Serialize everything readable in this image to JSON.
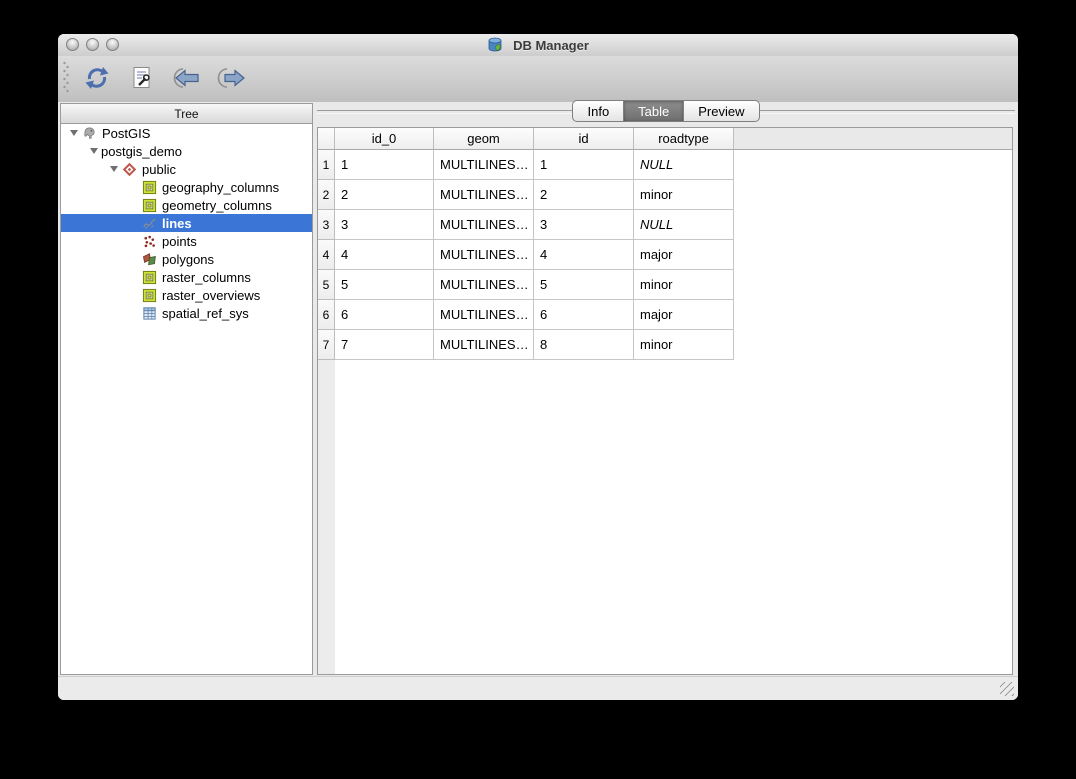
{
  "window": {
    "title": "DB Manager",
    "traffic_lights": [
      {
        "name": "close"
      },
      {
        "name": "minimize"
      },
      {
        "name": "zoom"
      }
    ]
  },
  "toolbar": {
    "buttons": [
      {
        "icon": "refresh-icon"
      },
      {
        "icon": "sql-window-icon"
      },
      {
        "icon": "import-layer-icon"
      },
      {
        "icon": "export-file-icon"
      }
    ]
  },
  "tree_panel": {
    "header": "Tree",
    "items": [
      {
        "label": "PostGIS",
        "depth": 0,
        "expanded": true,
        "icon": "postgis-icon",
        "selected": false
      },
      {
        "label": "postgis_demo",
        "depth": 1,
        "expanded": true,
        "icon": null,
        "selected": false
      },
      {
        "label": "public",
        "depth": 2,
        "expanded": true,
        "icon": "schema-icon",
        "selected": false
      },
      {
        "label": "geography_columns",
        "depth": 3,
        "expanded": false,
        "icon": "table-layer-icon",
        "selected": false
      },
      {
        "label": "geometry_columns",
        "depth": 3,
        "expanded": false,
        "icon": "table-layer-icon",
        "selected": false
      },
      {
        "label": "lines",
        "depth": 3,
        "expanded": false,
        "icon": "line-layer-icon",
        "selected": true
      },
      {
        "label": "points",
        "depth": 3,
        "expanded": false,
        "icon": "point-layer-icon",
        "selected": false
      },
      {
        "label": "polygons",
        "depth": 3,
        "expanded": false,
        "icon": "polygon-layer-icon",
        "selected": false
      },
      {
        "label": "raster_columns",
        "depth": 3,
        "expanded": false,
        "icon": "table-layer-icon",
        "selected": false
      },
      {
        "label": "raster_overviews",
        "depth": 3,
        "expanded": false,
        "icon": "table-layer-icon",
        "selected": false
      },
      {
        "label": "spatial_ref_sys",
        "depth": 3,
        "expanded": false,
        "icon": "spatial-table-icon",
        "selected": false
      }
    ]
  },
  "tabs": {
    "items": [
      {
        "label": "Info",
        "active": false
      },
      {
        "label": "Table",
        "active": true
      },
      {
        "label": "Preview",
        "active": false
      }
    ]
  },
  "table": {
    "columns": [
      "id_0",
      "geom",
      "id",
      "roadtype"
    ],
    "rows": [
      {
        "num": "1",
        "id_0": "1",
        "geom": "MULTILINES…",
        "id": "1",
        "roadtype": "NULL"
      },
      {
        "num": "2",
        "id_0": "2",
        "geom": "MULTILINES…",
        "id": "2",
        "roadtype": "minor"
      },
      {
        "num": "3",
        "id_0": "3",
        "geom": "MULTILINES…",
        "id": "3",
        "roadtype": "NULL"
      },
      {
        "num": "4",
        "id_0": "4",
        "geom": "MULTILINES…",
        "id": "4",
        "roadtype": "major"
      },
      {
        "num": "5",
        "id_0": "5",
        "geom": "MULTILINES…",
        "id": "5",
        "roadtype": "minor"
      },
      {
        "num": "6",
        "id_0": "6",
        "geom": "MULTILINES…",
        "id": "6",
        "roadtype": "major"
      },
      {
        "num": "7",
        "id_0": "7",
        "geom": "MULTILINES…",
        "id": "8",
        "roadtype": "minor"
      }
    ]
  },
  "colors": {
    "selection_blue": "#3b76d7",
    "toolbar_icon_blue": "#4d6fae",
    "layer_green": "#cde13a",
    "schema_red": "#c0574b",
    "point_red": "#8e2a21",
    "selected_text": "#ffffff"
  }
}
